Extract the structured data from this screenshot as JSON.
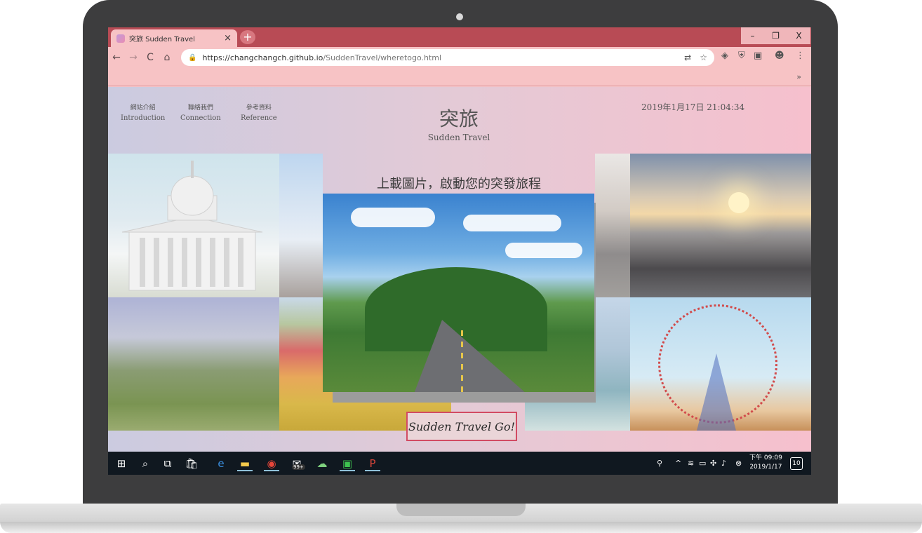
{
  "browser": {
    "tab_title": "突旅 Sudden Travel",
    "tab_close": "×",
    "new_tab": "+",
    "window_controls": {
      "minimize": "–",
      "maximize": "❐",
      "close": "X"
    },
    "nav": {
      "back": "←",
      "forward": "→",
      "reload": "C",
      "home": "⌂"
    },
    "url_host": "https://changchangch.github.io",
    "url_path": "/SuddenTravel/wheretogo.html",
    "bookmarks_overflow": "»"
  },
  "site": {
    "nav_items": [
      {
        "cn": "網站介紹",
        "en": "Introduction"
      },
      {
        "cn": "聯絡我們",
        "en": "Connection"
      },
      {
        "cn": "參考資料",
        "en": "Reference"
      }
    ],
    "logo_cn": "突旅",
    "logo_en": "Sudden Travel",
    "datetime": "2019年1月17日 21:04:34",
    "headline": "上載圖片，啟動您的突發旅程",
    "go_button": "Sudden Travel Go!"
  },
  "taskbar": {
    "mail_badge": "99+",
    "clock_time": "下午 09:09",
    "clock_date": "2019/1/17",
    "notification_count": "10"
  }
}
